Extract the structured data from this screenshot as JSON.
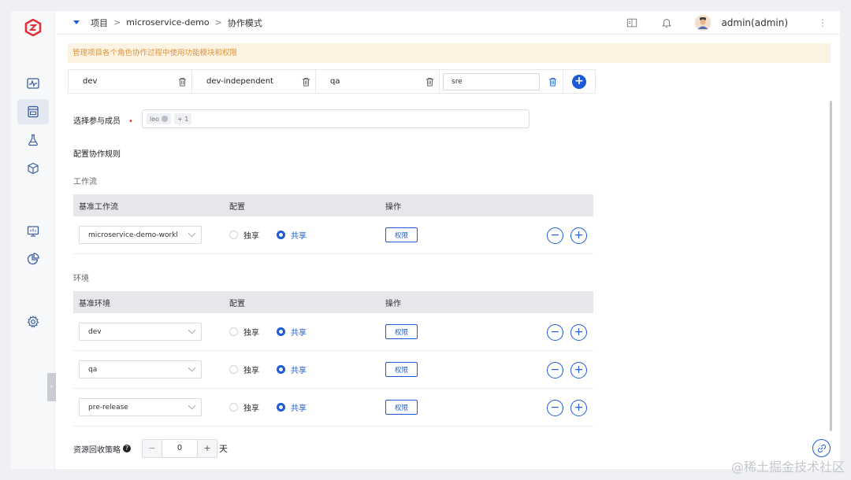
{
  "breadcrumb": {
    "items": [
      "项目",
      "microservice-demo",
      "协作模式"
    ],
    "separator": ">"
  },
  "user": {
    "name": "admin(admin)"
  },
  "notice": "管理项目各个角色协作过程中使用功能模块和权限",
  "tabs": [
    {
      "label": "dev"
    },
    {
      "label": "dev-independent"
    },
    {
      "label": "qa"
    }
  ],
  "editing_tab": {
    "value": "sre"
  },
  "members": {
    "label": "选择参与成员",
    "required_mark": "•",
    "chips": [
      "leo",
      "+ 1"
    ]
  },
  "rules_title": "配置协作规则",
  "workflow": {
    "title": "工作流",
    "headers": [
      "基准工作流",
      "配置",
      "操作"
    ],
    "rows": [
      {
        "base": "microservice-demo-workl",
        "option_exclusive": "独享",
        "option_shared": "共享",
        "selected": "共享",
        "perm_label": "权限"
      }
    ]
  },
  "environment": {
    "title": "环境",
    "headers": [
      "基准环境",
      "配置",
      "操作"
    ],
    "rows": [
      {
        "base": "dev",
        "option_exclusive": "独享",
        "option_shared": "共享",
        "selected": "共享",
        "perm_label": "权限"
      },
      {
        "base": "qa",
        "option_exclusive": "独享",
        "option_shared": "共享",
        "selected": "共享",
        "perm_label": "权限"
      },
      {
        "base": "pre-release",
        "option_exclusive": "独享",
        "option_shared": "共享",
        "selected": "共享",
        "perm_label": "权限"
      }
    ]
  },
  "recycle": {
    "label": "资源回收策略",
    "help": "?",
    "minus": "−",
    "value": "0",
    "plus": "+",
    "unit": "天"
  },
  "op_minus": "−",
  "op_plus": "+",
  "watermark": "@稀土掘金技术社区",
  "colors": {
    "primary": "#1d5bd6",
    "notice_bg": "#fdf3e3",
    "notice_text": "#e0933a",
    "header_bg": "#e6e7ea",
    "required": "#e03c3c"
  },
  "icons": [
    "logo-icon",
    "monitor-wave-icon",
    "project-icon",
    "flask-icon",
    "package-icon",
    "dashboard-icon",
    "pie-chart-icon",
    "settings-icon",
    "book-icon",
    "bell-icon",
    "more-icon",
    "trash-icon",
    "add-icon",
    "link-icon"
  ]
}
